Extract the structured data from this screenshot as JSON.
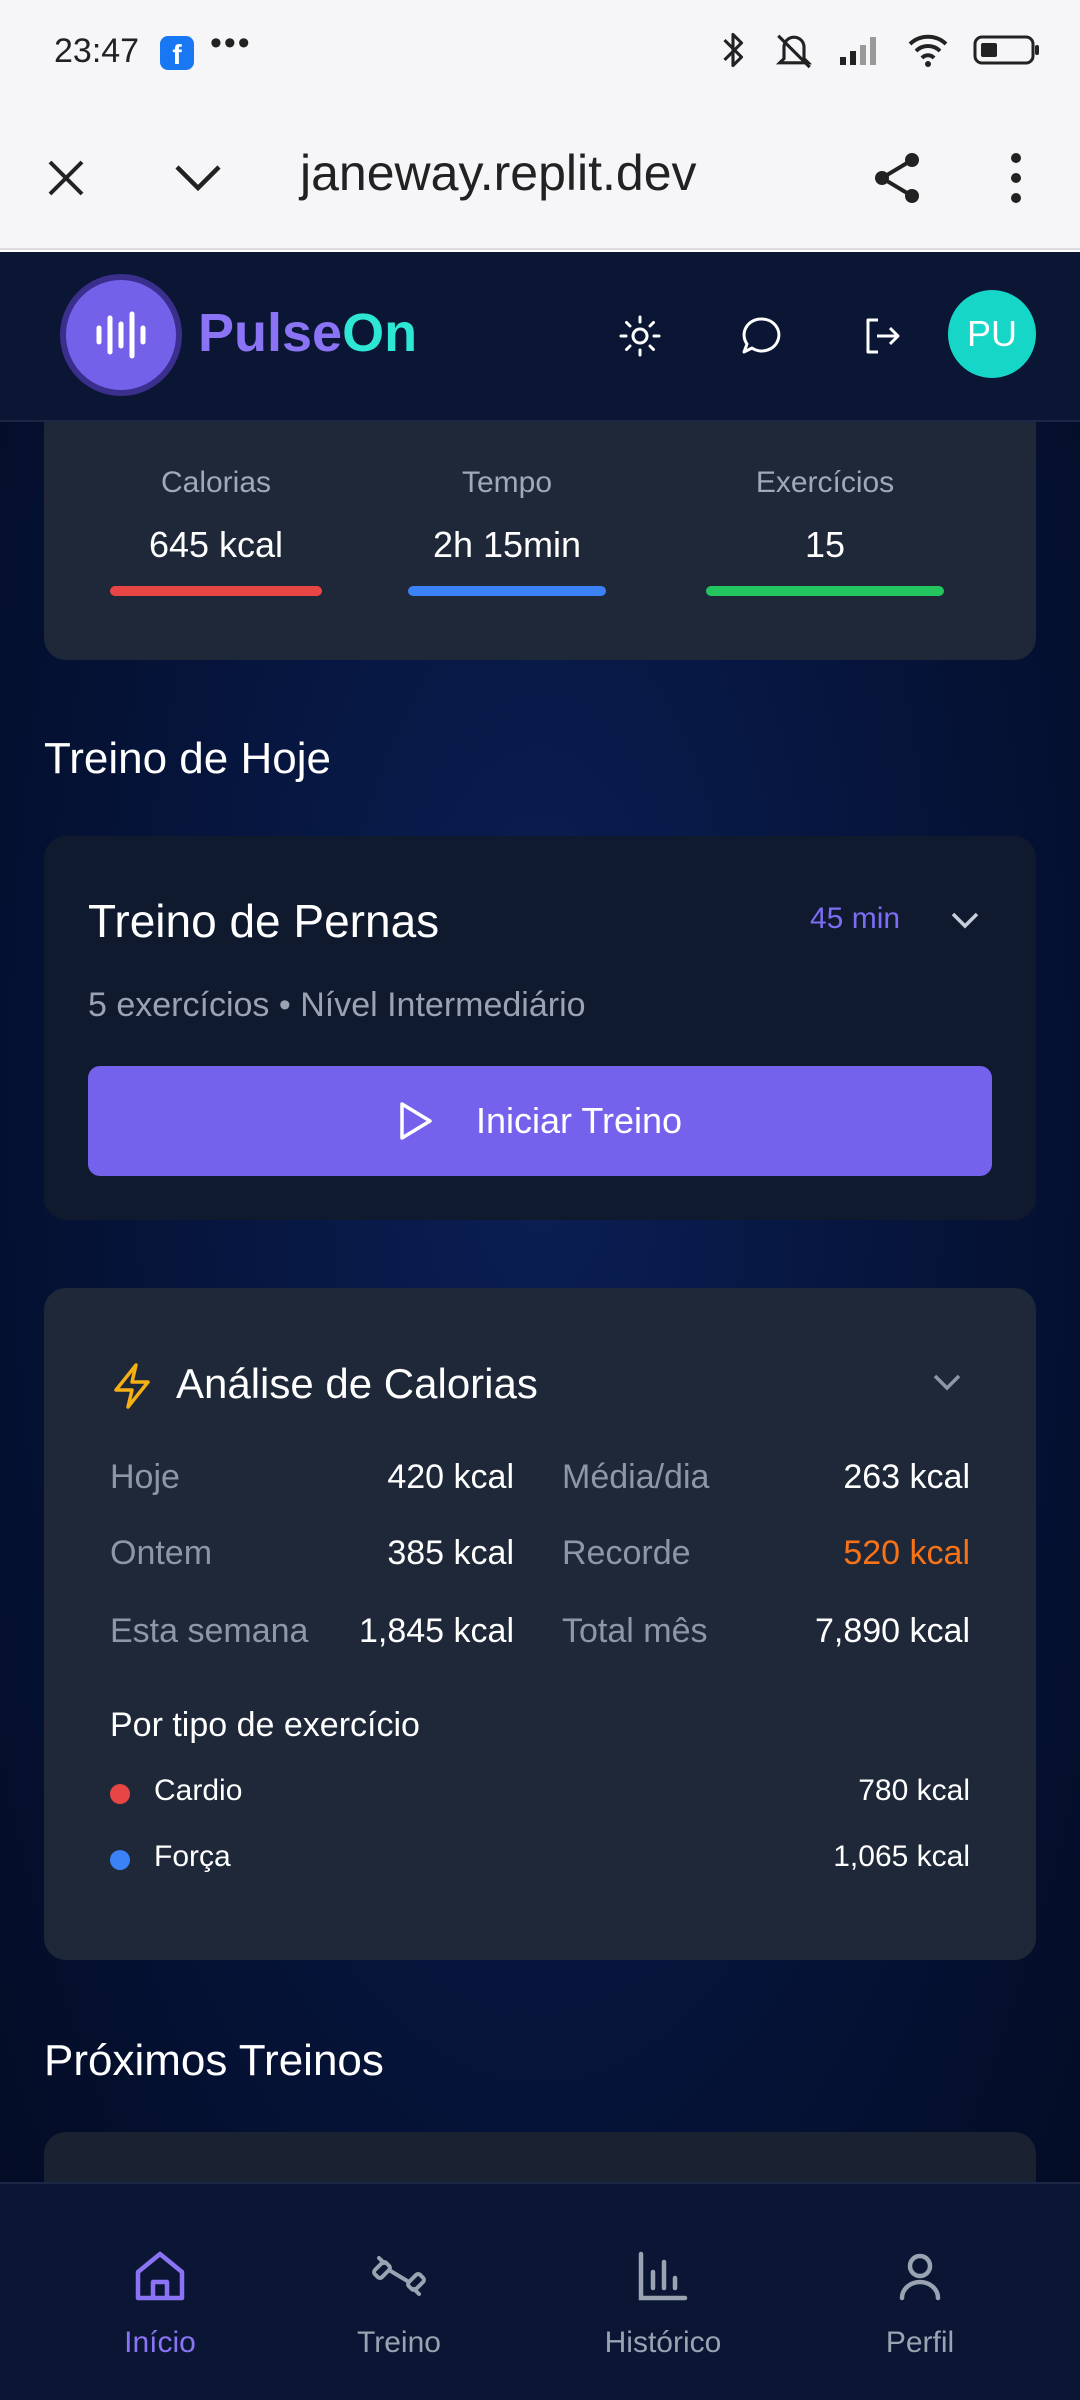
{
  "statusbar": {
    "time": "23:47",
    "dots": "•••",
    "facebook_icon": "f"
  },
  "browser": {
    "url": "janeway.replit.dev"
  },
  "app": {
    "brand_part1": "Pulse",
    "brand_part2": "On",
    "avatar_initials": "PU",
    "colors": {
      "accent": "#7462ec",
      "teal": "#2ee6d4",
      "red": "#e84545",
      "blue": "#3b82f6",
      "green": "#22c55e",
      "orange": "#f97316"
    }
  },
  "stats": {
    "calories_label": "Calorias",
    "calories_value": "645 kcal",
    "time_label": "Tempo",
    "time_value": "2h 15min",
    "exercises_label": "Exercícios",
    "exercises_value": "15"
  },
  "today": {
    "section_title": "Treino de Hoje",
    "workout_title": "Treino de Pernas",
    "duration": "45 min",
    "subtitle": "5 exercícios • Nível Intermediário",
    "start_label": "Iniciar Treino"
  },
  "calories": {
    "title": "Análise de Calorias",
    "today_label": "Hoje",
    "today_value": "420 kcal",
    "avg_label": "Média/dia",
    "avg_value": "263 kcal",
    "yesterday_label": "Ontem",
    "yesterday_value": "385 kcal",
    "record_label": "Recorde",
    "record_value": "520 kcal",
    "week_label": "Esta semana",
    "week_value": "1,845 kcal",
    "month_label": "Total mês",
    "month_value": "7,890 kcal",
    "by_type_title": "Por tipo de exercício",
    "types": [
      {
        "name": "Cardio",
        "value": "780 kcal"
      },
      {
        "name": "Força",
        "value": "1,065 kcal"
      }
    ]
  },
  "next": {
    "section_title": "Próximos Treinos"
  },
  "bottom_nav": {
    "items": [
      {
        "label": "Início"
      },
      {
        "label": "Treino"
      },
      {
        "label": "Histórico"
      },
      {
        "label": "Perfil"
      }
    ]
  }
}
